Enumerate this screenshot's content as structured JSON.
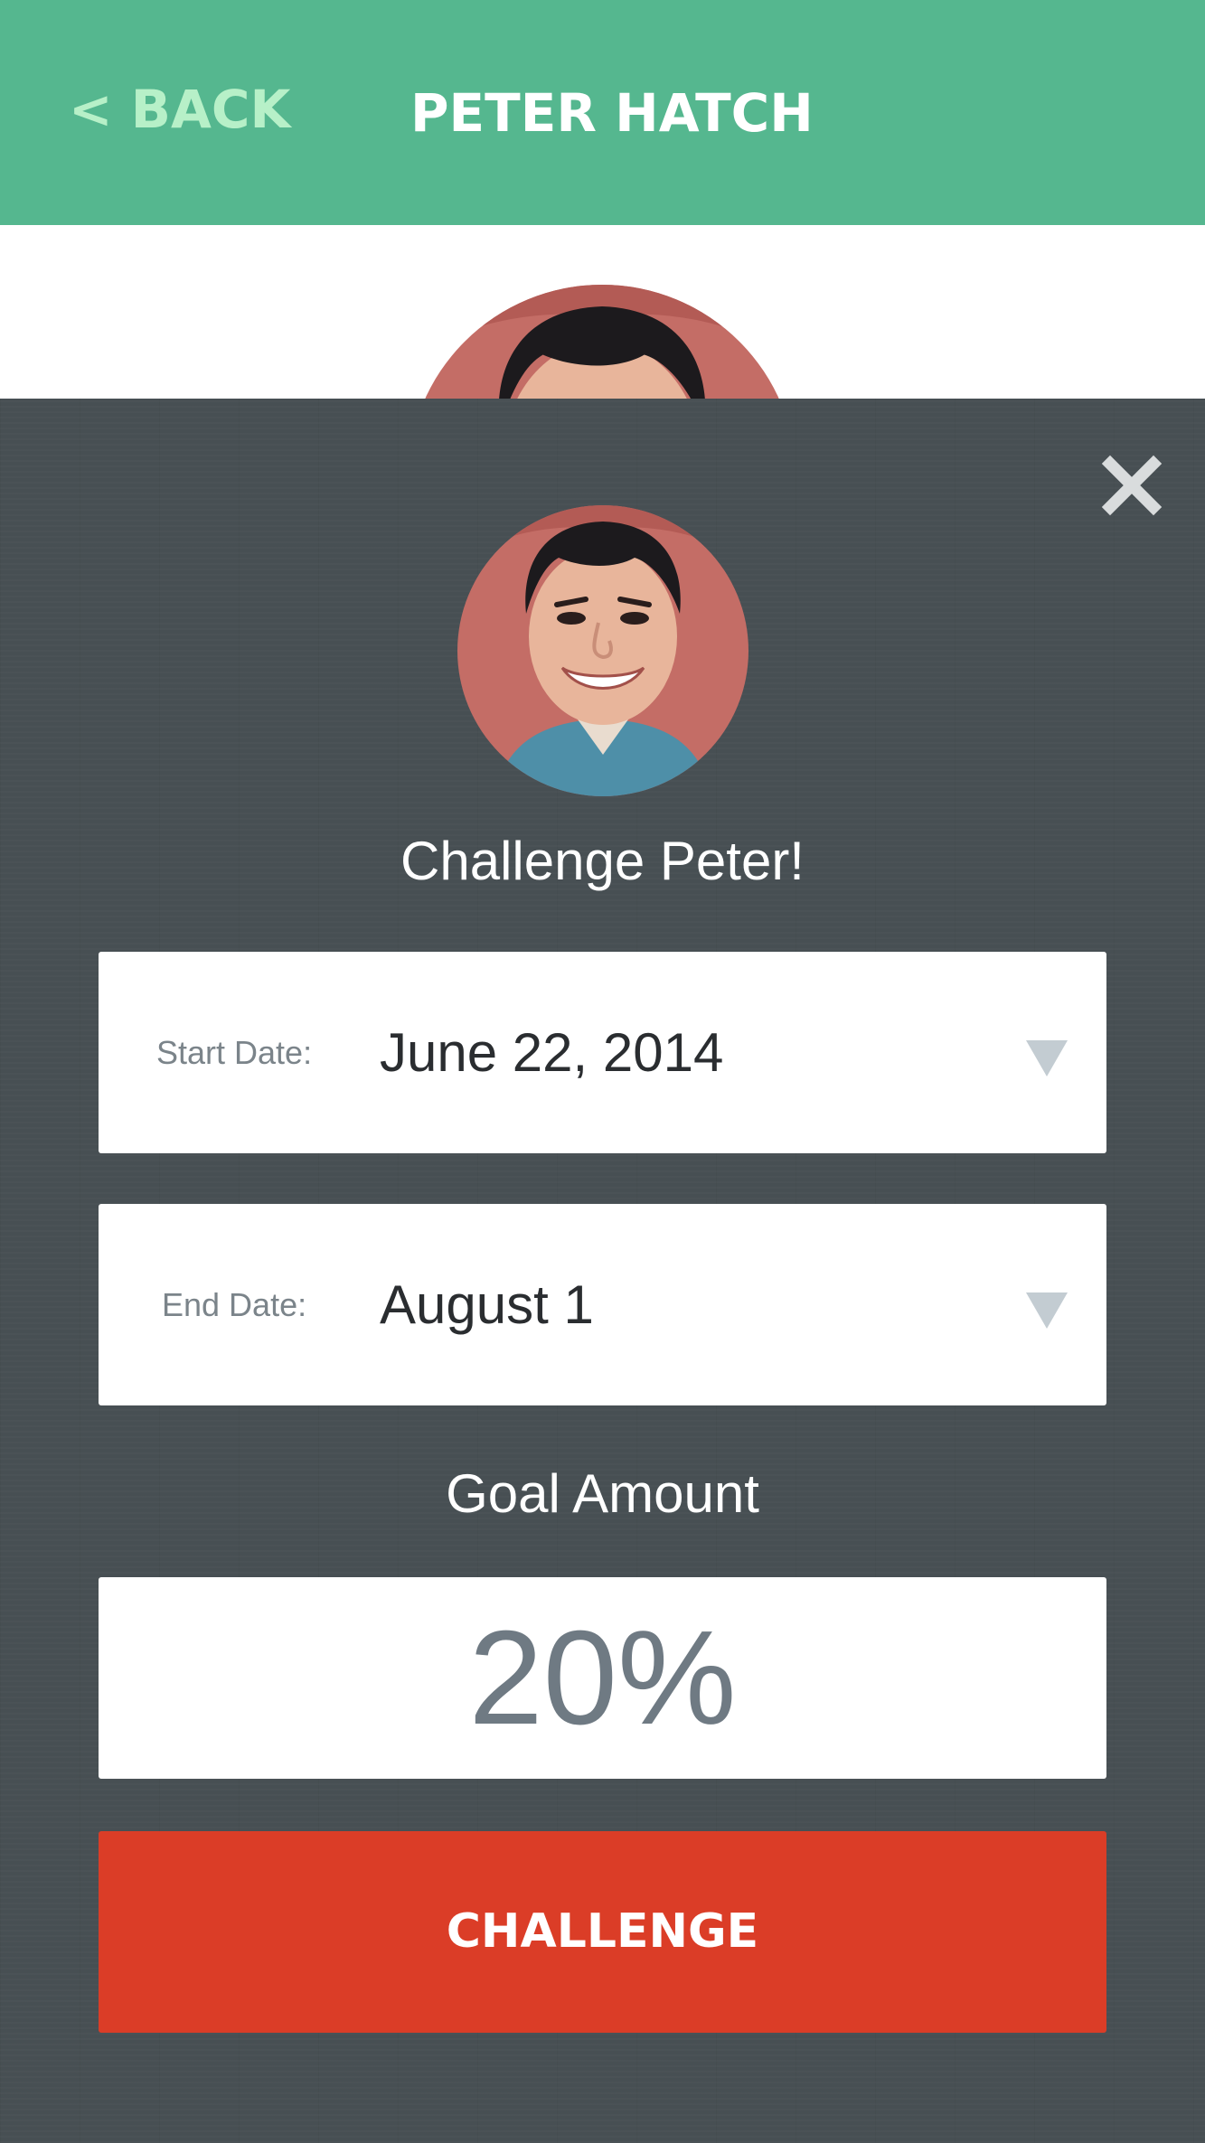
{
  "header": {
    "back_label": "< BACK",
    "title": "PETER HATCH",
    "background_color": "#55b78f",
    "back_color": "#b7f0c8"
  },
  "modal": {
    "close_icon": "close-icon",
    "title": "Challenge Peter!",
    "start_date": {
      "label": "Start Date:",
      "value": "June 22, 2014"
    },
    "end_date": {
      "label": "End Date:",
      "value": "August 1"
    },
    "goal": {
      "label": "Goal Amount",
      "value": "20%"
    },
    "challenge_button": {
      "label": "CHALLENGE",
      "color": "#db3d27"
    },
    "background_color": "#474f53"
  }
}
